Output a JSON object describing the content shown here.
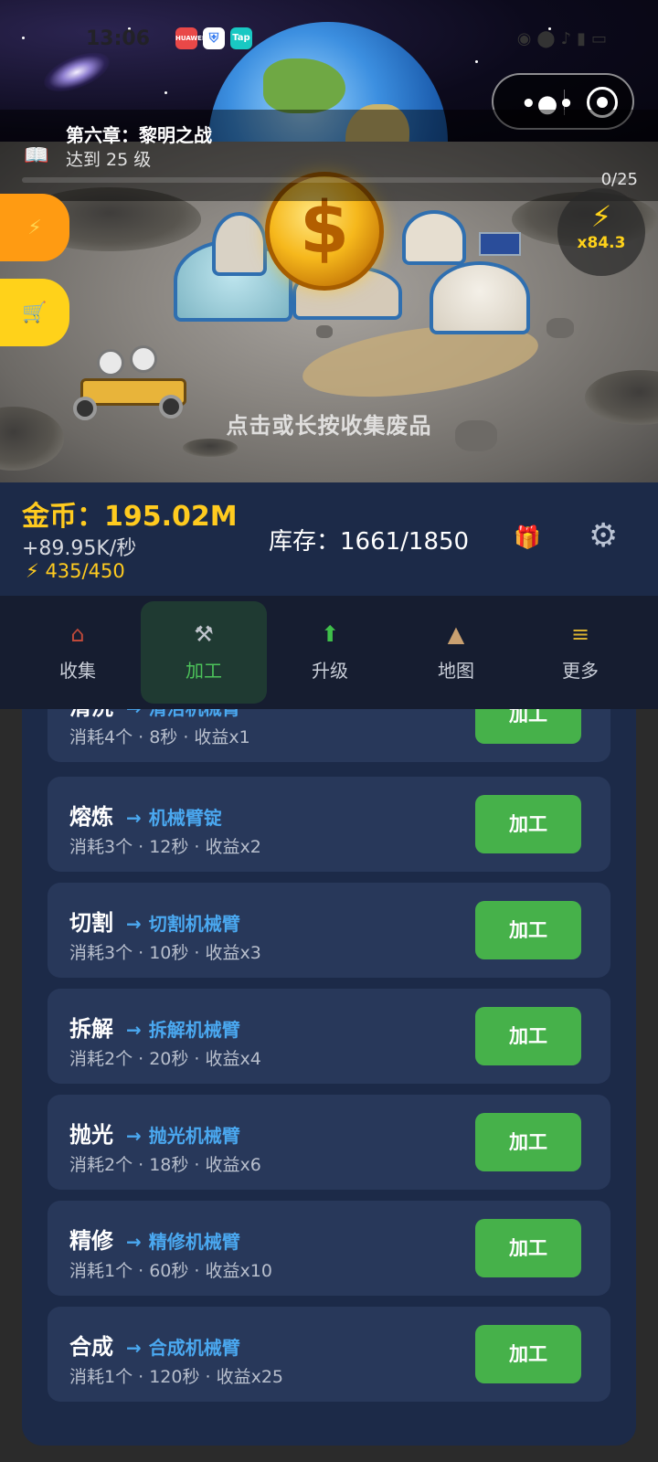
{
  "status_bar": {
    "time": "13:06",
    "apps": [
      {
        "name": "huawei-app-icon",
        "label": "HUAWEI",
        "color": "#e94848"
      },
      {
        "name": "shield-app-icon",
        "label": "",
        "color": "#3a7ef0"
      },
      {
        "name": "taptap-app-icon",
        "label": "Tap",
        "color": "#19c8c3"
      }
    ],
    "right_icons": [
      "eye-icon",
      "location-icon",
      "mute-icon",
      "signal-icon",
      "battery-icon"
    ]
  },
  "quest": {
    "title": "第六章：黎明之战",
    "description": "达到 25 级",
    "progress_text": "0/25"
  },
  "multiplier": {
    "value": "x84.3"
  },
  "scene": {
    "hint": "点击或长按收集废品"
  },
  "resources": {
    "gold": "金币：195.02M",
    "rate": "+89.95K/秒",
    "energy": "435/450",
    "inventory": "库存：1661/1850"
  },
  "nav": {
    "tabs": [
      {
        "label": "收集",
        "icon": "barn-icon",
        "active": false
      },
      {
        "label": "加工",
        "icon": "hammer-icon",
        "active": true
      },
      {
        "label": "升级",
        "icon": "up-arrow-icon",
        "active": false
      },
      {
        "label": "地图",
        "icon": "map-icon",
        "active": false
      },
      {
        "label": "更多",
        "icon": "menu-icon",
        "active": false
      }
    ]
  },
  "recipes": [
    {
      "name": "清洗",
      "product": "清洁机械臂",
      "meta": "消耗4个 · 8秒 · 收益x1",
      "button": "加工"
    },
    {
      "name": "熔炼",
      "product": "机械臂锭",
      "meta": "消耗3个 · 12秒 · 收益x2",
      "button": "加工"
    },
    {
      "name": "切割",
      "product": "切割机械臂",
      "meta": "消耗3个 · 10秒 · 收益x3",
      "button": "加工"
    },
    {
      "name": "拆解",
      "product": "拆解机械臂",
      "meta": "消耗2个 · 20秒 · 收益x4",
      "button": "加工"
    },
    {
      "name": "抛光",
      "product": "抛光机械臂",
      "meta": "消耗2个 · 18秒 · 收益x6",
      "button": "加工"
    },
    {
      "name": "精修",
      "product": "精修机械臂",
      "meta": "消耗1个 · 60秒 · 收益x10",
      "button": "加工"
    },
    {
      "name": "合成",
      "product": "合成机械臂",
      "meta": "消耗1个 · 120秒 · 收益x25",
      "button": "加工"
    }
  ],
  "colors": {
    "gold": "#ffcb1f",
    "accent_green": "#46b14a",
    "link_blue": "#4aa8f0",
    "panel": "#1c2a48"
  }
}
